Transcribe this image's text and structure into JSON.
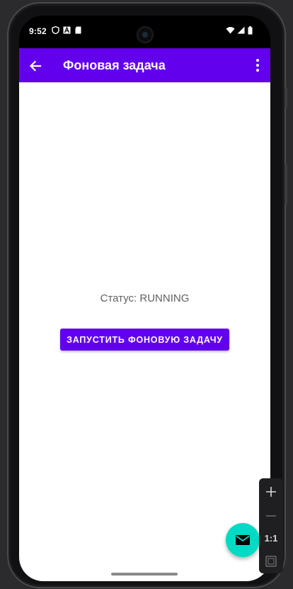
{
  "statusbar": {
    "time": "9:52",
    "icons": [
      "shield-icon",
      "a-icon",
      "sd-card-icon",
      "wifi-icon",
      "signal-icon",
      "battery-icon"
    ]
  },
  "appbar": {
    "title": "Фоновая задача",
    "back_icon": "arrow-back-icon",
    "menu_icon": "more-vert-icon",
    "color": "#6200ee"
  },
  "content": {
    "status_text": "Статус: RUNNING",
    "start_button_label": "ЗАПУСТИТЬ ФОНОВУЮ ЗАДАЧУ"
  },
  "fab": {
    "icon": "email-icon",
    "color": "#03dac5"
  },
  "zoom_toolbar": {
    "zoom_in_icon": "plus-icon",
    "zoom_out_icon": "minus-icon",
    "actual_size_label": "1:1",
    "fit_icon": "fit-screen-icon"
  }
}
